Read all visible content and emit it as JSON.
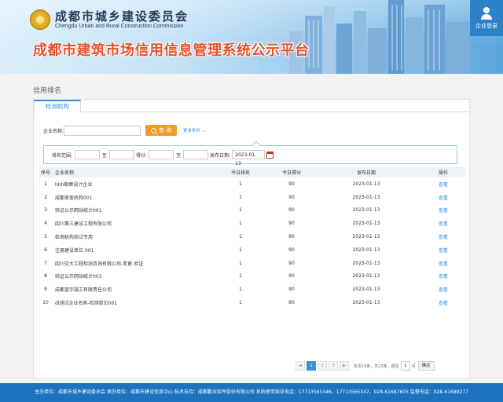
{
  "header": {
    "org_name_cn": "成都市城乡建设委员会",
    "org_name_en": "Chengdu Urban and Rural Construction Commission",
    "system_title": "成都市建筑市场信用信息管理系统公示平台",
    "login_label": "企业登录"
  },
  "page": {
    "section_title": "信用排名",
    "tab_label": "检测机构"
  },
  "search": {
    "company_label": "企业名称:",
    "company_value": "",
    "query_button": "查 询",
    "more_conditions": "更多条件"
  },
  "filters": {
    "rank_label": "排名范围:",
    "to1": "至",
    "score_label": "得分:",
    "to2": "至",
    "date_label": "发布日期:",
    "date_value": "2023-01-13"
  },
  "table": {
    "columns": [
      "序号",
      "企业名称",
      "今日排名",
      "今日得分",
      "发布日期",
      "操作"
    ],
    "rows": [
      [
        "1",
        "hhh勘察设计企业",
        "1",
        "90",
        "2023-01-13",
        "查看"
      ],
      [
        "2",
        "成都审查机构001",
        "1",
        "90",
        "2023-01-13",
        "查看"
      ],
      [
        "3",
        "验证公示网站统计001",
        "1",
        "90",
        "2023-01-13",
        "查看"
      ],
      [
        "4",
        "四川第三建设工程有限公司",
        "1",
        "90",
        "2023-01-13",
        "查看"
      ],
      [
        "5",
        "检测机构测试专用",
        "1",
        "90",
        "2023-01-13",
        "查看"
      ],
      [
        "6",
        "注册建设单位 001",
        "1",
        "90",
        "2023-01-13",
        "查看"
      ],
      [
        "7",
        "四川交大工程检测咨询有限公司-变更-验证",
        "1",
        "90",
        "2023-01-13",
        "查看"
      ],
      [
        "8",
        "验证公示网站统计003",
        "1",
        "90",
        "2023-01-13",
        "查看"
      ],
      [
        "9",
        "成都蓝宇施工有限责任公司",
        "1",
        "90",
        "2023-01-13",
        "查看"
      ],
      [
        "10",
        "dl测试企业名称-检测单位001",
        "1",
        "90",
        "2023-01-13",
        "查看"
      ]
    ]
  },
  "pagination": {
    "prev": "◀",
    "pages": [
      "1",
      "2",
      "3"
    ],
    "next": "▶",
    "summary": "本页10条，共23条，跳至",
    "goto_value": "1",
    "page_unit": "页",
    "go_button": "确定"
  },
  "footer": {
    "text": "主办单位：成都市城乡建设委员会  承办单位：成都市建设信息中心  技术支持：成都鹏业软件股份有限公司  系统使用指导电话：17713565346、17713565347、028-61687605  监督电话：028-61689277"
  }
}
